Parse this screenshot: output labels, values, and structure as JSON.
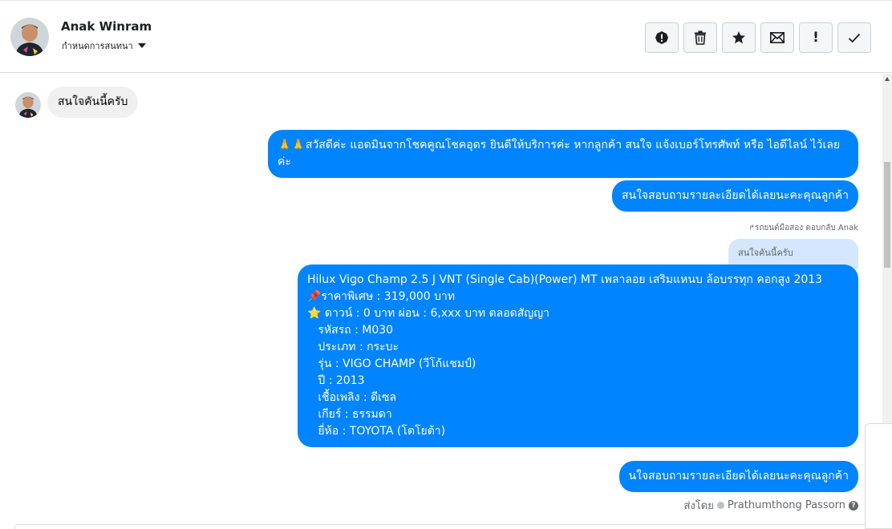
{
  "header": {
    "contact_name": "Anak Winram",
    "assign_label": "กำหนดการสนทนา",
    "toolbar": {
      "alert_icon": "exclamation-circle-icon",
      "delete_icon": "trash-icon",
      "star_icon": "star-icon",
      "mail_icon": "envelope-icon",
      "important_label": "!",
      "done_icon": "checkmark-icon"
    }
  },
  "messages": {
    "incoming_1": "สนใจคันนี้ครับ",
    "outgoing_1": "🙏🙏สวัสดีค่ะ แอดมินจากโชคคูณโชคอุดร ยินดีให้บริการค่ะ หากลูกค้า สนใจ แจ้งเบอร์โทรศัพท์ หรือ ไอดีไลน์ ไว้เลยค่ะ",
    "outgoing_2": "สนใจสอบถามรายละเอียดได้เลยนะคะคุณลูกค้า",
    "reply_meta": "รถยนต์มือสอง ตอบกลับ Anak",
    "quoted_text": "สนใจคันนี้ครับ",
    "listing_lines": [
      "Hilux Vigo Champ 2.5 J VNT (Single Cab)(Power) MT เพลาลอย เสริมแหนบ ล้อบรรทุก คอกสูง 2013",
      "📌ราคาพิเศษ : 319,000 บาท",
      "⭐ ดาวน์ : 0 บาท ผ่อน : 6,xxx บาท ตลอดสัญญา",
      "   รหัสรถ : M030",
      "   ประเภท : กระบะ",
      "   รุ่น : VIGO CHAMP (วีโก้แชมป์)",
      "   ปี : 2013",
      "   เชื้อเพลิง : ดีเซล",
      "   เกียร์ : ธรรมดา",
      "   ยี่ห้อ : TOYOTA (โตโยต้า)"
    ],
    "outgoing_3": "นใจสอบถามรายละเอียดได้เลยนะคะคุณลูกค้า",
    "sent_by_label": "ส่งโดย",
    "sent_by_name": "Prathumthong Passorn"
  },
  "colors": {
    "outgoing_bubble": "#0084ff",
    "incoming_bubble": "#f0f0f0",
    "quoted_bubble": "#d4e7fe"
  }
}
